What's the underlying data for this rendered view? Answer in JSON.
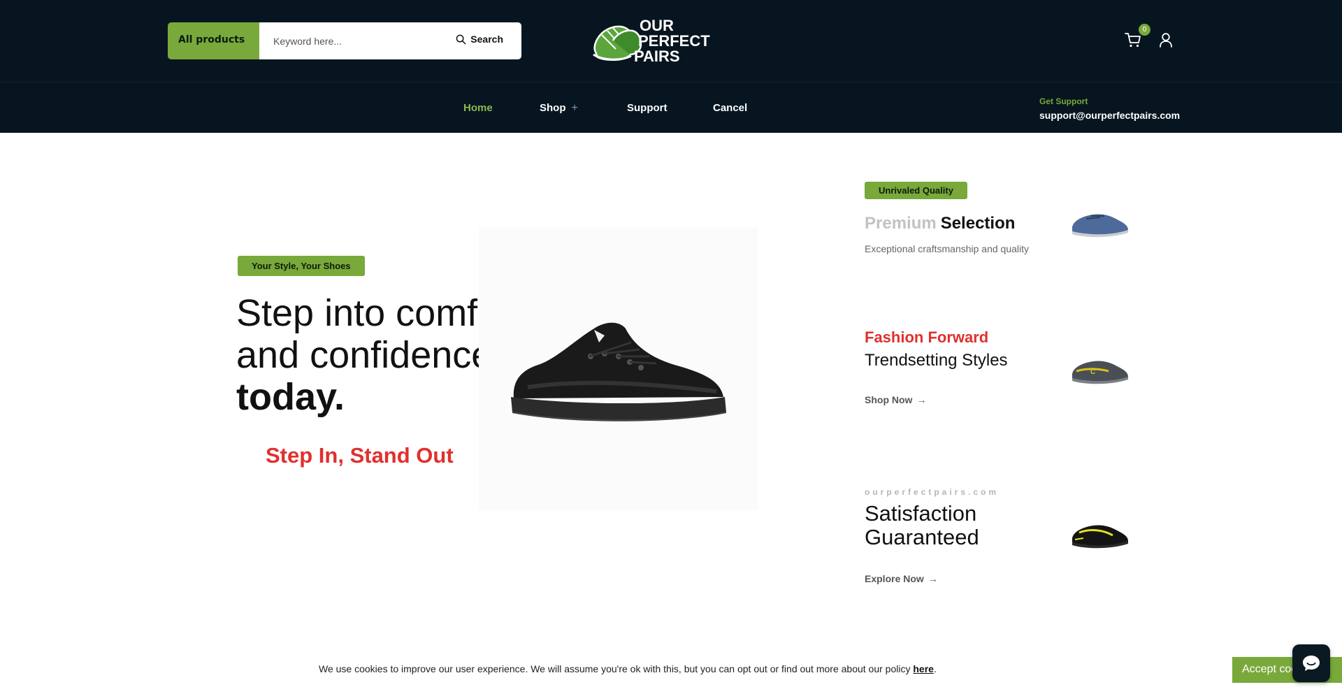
{
  "header": {
    "category_label": "All products",
    "search_placeholder": "Keyword here...",
    "search_label": "Search",
    "logo_line1": "OUR",
    "logo_line2": "PERFECT",
    "logo_line3": "PAIRS",
    "cart_count": "0"
  },
  "nav": {
    "items": [
      {
        "label": "Home"
      },
      {
        "label": "Shop"
      },
      {
        "label": "Support"
      },
      {
        "label": "Cancel"
      }
    ],
    "shop_plus": "+",
    "support_label": "Get Support",
    "support_email": "support@ourperfectpairs.com"
  },
  "hero": {
    "tag": "Your Style, Your Shoes",
    "title_line1": "Step into comfort",
    "title_line2": "and confidence",
    "title_line3": "today.",
    "slogan": "Step In, Stand Out"
  },
  "features": {
    "f1_badge": "Unrivaled Quality",
    "f1_title_light": "Premium",
    "f1_title_dark": "Selection",
    "f1_desc": "Exceptional craftsmanship and quality",
    "f2_red": "Fashion Forward",
    "f2_title": "Trendsetting Styles",
    "f2_link": "Shop Now",
    "f3_site": "ourperfectpairs.com",
    "f3_title": "Satisfaction Guaranteed",
    "f3_link": "Explore Now",
    "arrow": "→"
  },
  "cookie": {
    "text": "We use cookies to improve our user experience. We will assume you're ok with this, but you can opt out or find out more about our policy ",
    "link": "here",
    "period": ".",
    "accept_label": "Accept cookies"
  },
  "colors": {
    "header_bg": "#071520",
    "accent_green": "#79a93a",
    "accent_red": "#e0302e"
  },
  "icons": [
    "search-icon",
    "cart-icon",
    "user-icon",
    "arrow-right-icon",
    "chat-icon"
  ]
}
